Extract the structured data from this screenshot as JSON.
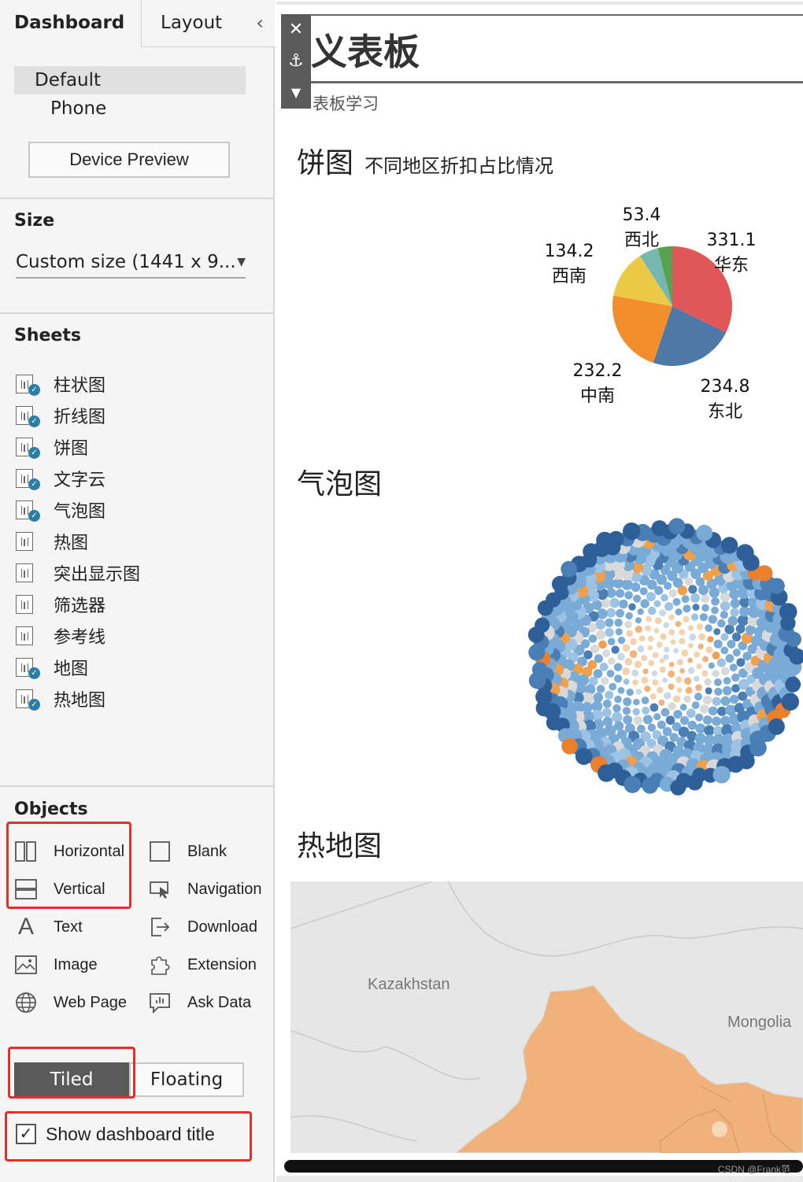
{
  "left_panel": {
    "tabs": [
      "Dashboard",
      "Layout"
    ],
    "collapse_icon": "chevron-left-icon",
    "device": {
      "default": "Default",
      "phone": "Phone",
      "preview_button": "Device Preview"
    },
    "size": {
      "title": "Size",
      "value": "Custom size (1441 x 9...",
      "arrow_icon": "caret-down-icon"
    },
    "sheets": {
      "title": "Sheets",
      "items": [
        {
          "label": "柱状图",
          "used": true
        },
        {
          "label": "折线图",
          "used": true
        },
        {
          "label": "饼图",
          "used": true
        },
        {
          "label": "文字云",
          "used": true
        },
        {
          "label": "气泡图",
          "used": true
        },
        {
          "label": "热图",
          "used": false
        },
        {
          "label": "突出显示图",
          "used": false
        },
        {
          "label": "筛选器",
          "used": false
        },
        {
          "label": "参考线",
          "used": false
        },
        {
          "label": "地图",
          "used": true
        },
        {
          "label": "热地图",
          "used": true
        }
      ]
    },
    "objects": {
      "title": "Objects",
      "items": [
        {
          "label": "Horizontal",
          "icon": "horizontal-container-icon"
        },
        {
          "label": "Blank",
          "icon": "blank-icon"
        },
        {
          "label": "Vertical",
          "icon": "vertical-container-icon"
        },
        {
          "label": "Navigation",
          "icon": "navigation-icon"
        },
        {
          "label": "Text",
          "icon": "text-icon"
        },
        {
          "label": "Download",
          "icon": "download-icon"
        },
        {
          "label": "Image",
          "icon": "image-icon"
        },
        {
          "label": "Extension",
          "icon": "extension-icon"
        },
        {
          "label": "Web Page",
          "icon": "web-page-icon"
        },
        {
          "label": "Ask Data",
          "icon": "ask-data-icon"
        }
      ]
    },
    "layout_mode": {
      "tiled": "Tiled",
      "floating": "Floating",
      "selected": "Tiled"
    },
    "show_title": {
      "label": "Show dashboard title",
      "checked": true
    }
  },
  "canvas": {
    "title": "义表板",
    "subtitle": "表板学习",
    "toolbar_icons": [
      "close-icon",
      "pin-icon",
      "caret-down-icon"
    ],
    "pie_title": "饼图",
    "pie_subtitle": "不同地区折扣占比情况",
    "bubble_title": "气泡图",
    "map_title": "热地图",
    "map_labels": {
      "kazakhstan": "Kazakhstan",
      "mongolia": "Mongolia"
    },
    "watermark": "CSDN @Frank范"
  },
  "chart_data": {
    "type": "pie",
    "categories": [
      "华东",
      "东北",
      "中南",
      "西南",
      "西北",
      "other"
    ],
    "values": [
      331.1,
      234.8,
      232.2,
      134.2,
      53.4,
      40
    ],
    "labels": [
      "331.1",
      "234.8",
      "232.2",
      "134.2",
      "53.4",
      ""
    ],
    "colors": [
      "#e15759",
      "#4e79a7",
      "#f28e2b",
      "#edc948",
      "#76b7b2",
      "#59a14f"
    ]
  }
}
